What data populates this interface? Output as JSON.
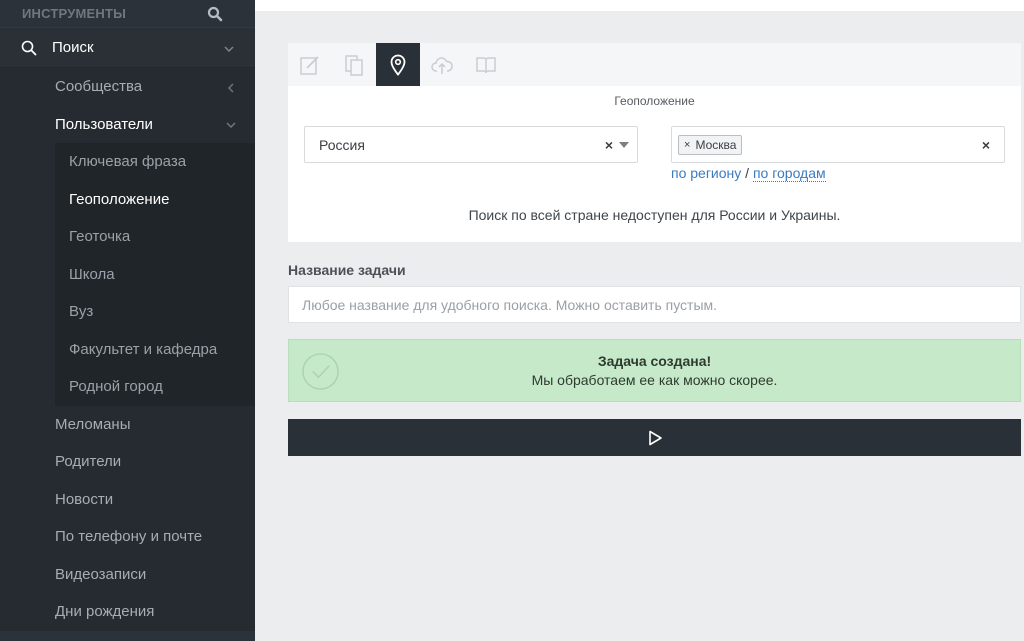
{
  "sidebar": {
    "header": "ИНСТРУМЕНТЫ",
    "root": "Поиск",
    "items": [
      {
        "label": "Сообщества"
      },
      {
        "label": "Пользователи"
      }
    ],
    "sub_items": [
      {
        "label": "Ключевая фраза"
      },
      {
        "label": "Геоположение"
      },
      {
        "label": "Геоточка"
      },
      {
        "label": "Школа"
      },
      {
        "label": "Вуз"
      },
      {
        "label": "Факультет и кафедра"
      },
      {
        "label": "Родной город"
      }
    ],
    "more_items": [
      {
        "label": "Меломаны"
      },
      {
        "label": "Родители"
      },
      {
        "label": "Новости"
      },
      {
        "label": "По телефону и почте"
      },
      {
        "label": "Видеозаписи"
      },
      {
        "label": "Дни рождения"
      }
    ]
  },
  "panel": {
    "section_label": "Геоположение",
    "country_value": "Россия",
    "city_tag": "Москва",
    "clear_symbol": "×",
    "link_region": "по региону",
    "link_separator": " / ",
    "link_cities": "по городам",
    "notice": "Поиск по всей стране недоступен для России и Украины."
  },
  "task": {
    "label": "Название задачи",
    "placeholder": "Любое название для удобного поиска. Можно оставить пустым."
  },
  "alert": {
    "title": "Задача создана!",
    "message": "Мы обработаем ее как можно скорее."
  },
  "colors": {
    "sidebar_bg": "#2c3239",
    "accent_dark": "#2a3038",
    "success_bg": "#c6e9c9",
    "link": "#3a7bbf"
  }
}
